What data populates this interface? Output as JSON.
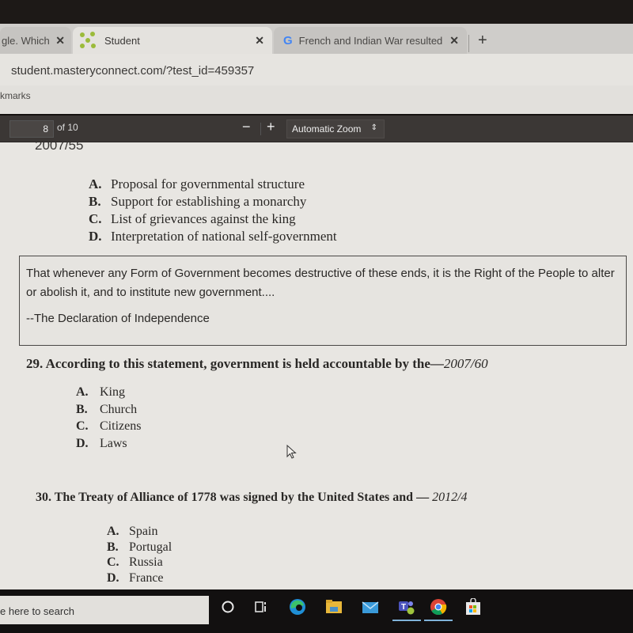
{
  "browser": {
    "tabs": [
      {
        "title": "gle. Which",
        "active": false,
        "close": "✕"
      },
      {
        "title": "Student",
        "active": true,
        "close": "✕",
        "icon": "masteryconnect-icon"
      },
      {
        "title": "French and Indian War resulted",
        "active": false,
        "close": "✕",
        "icon": "google-icon"
      }
    ],
    "new_tab": "+",
    "url": "student.masteryconnect.com/?test_id=459357",
    "bookmarks_label": "kmarks"
  },
  "pdf_toolbar": {
    "page_number": "8",
    "page_total": "of 10",
    "zoom_out": "−",
    "zoom_in": "+",
    "zoom_level": "Automatic Zoom",
    "zoom_arrows": "⇕"
  },
  "document": {
    "prev_question_code": "2007/55",
    "q28_choices": [
      {
        "letter": "A.",
        "text": "Proposal for governmental structure"
      },
      {
        "letter": "B.",
        "text": "Support for establishing a monarchy"
      },
      {
        "letter": "C.",
        "text": "List of grievances against the king"
      },
      {
        "letter": "D.",
        "text": "Interpretation of national self-government"
      }
    ],
    "quote": {
      "text": "That whenever any Form of Government becomes destructive of these ends, it is the Right of the People to alter or abolish it, and to institute new government....",
      "source": "--The Declaration of Independence"
    },
    "q29": {
      "number": "29.",
      "text": "According to this statement, government is held accountable by the—",
      "code": "2007/60",
      "choices": [
        {
          "letter": "A.",
          "text": "King"
        },
        {
          "letter": "B.",
          "text": "Church"
        },
        {
          "letter": "C.",
          "text": "Citizens"
        },
        {
          "letter": "D.",
          "text": "Laws"
        }
      ]
    },
    "q30": {
      "number": "30.",
      "text": "The Treaty of Alliance of 1778 was signed by the United States and — ",
      "code": "2012/4",
      "choices": [
        {
          "letter": "A.",
          "text": "Spain"
        },
        {
          "letter": "B.",
          "text": "Portugal"
        },
        {
          "letter": "C.",
          "text": "Russia"
        },
        {
          "letter": "D.",
          "text": "France"
        }
      ]
    }
  },
  "taskbar": {
    "search_placeholder": "e here to search",
    "icons": [
      "cortana-icon",
      "task-view-icon",
      "edge-icon",
      "file-explorer-icon",
      "mail-icon",
      "teams-icon",
      "chrome-icon",
      "store-icon"
    ]
  }
}
